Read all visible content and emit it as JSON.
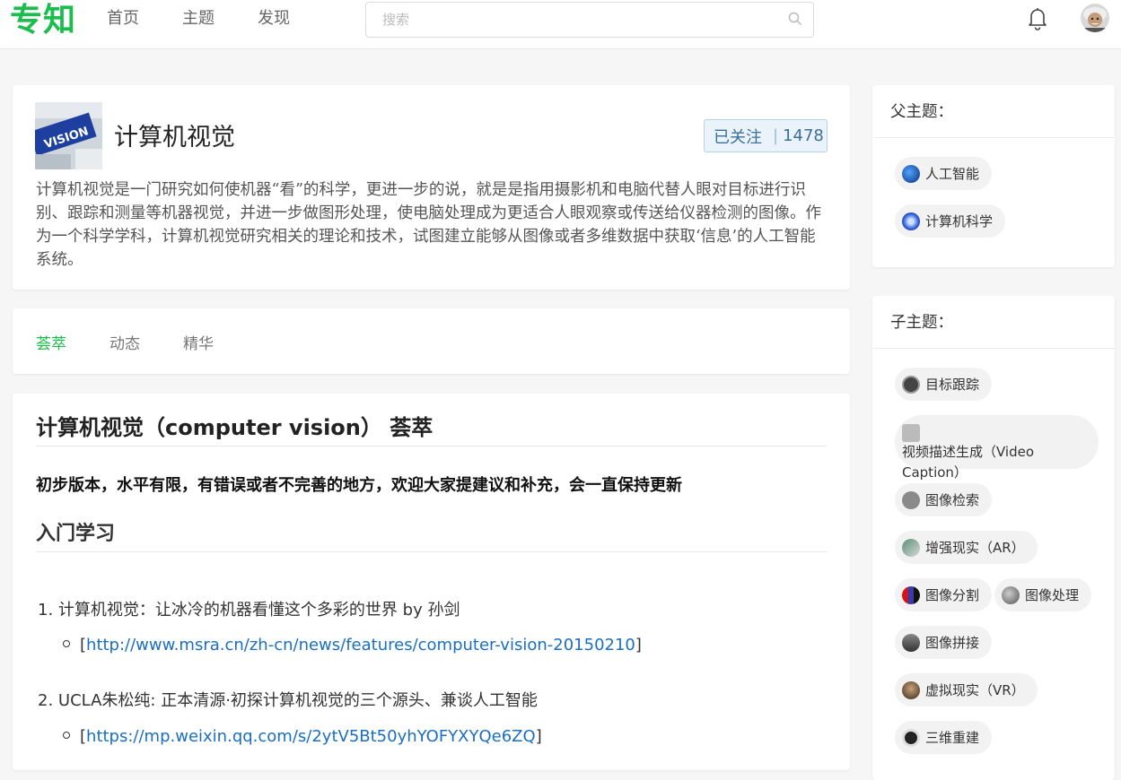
{
  "header": {
    "logo": "专知",
    "nav": [
      "首页",
      "主题",
      "发现"
    ],
    "search_placeholder": "搜索"
  },
  "topic": {
    "title": "计算机视觉",
    "image_label": "VISION",
    "follow_label": "已关注",
    "follow_count": "1478",
    "description": "计算机视觉是一门研究如何使机器“看”的科学，更进一步的说，就是是指用摄影机和电脑代替人眼对目标进行识别、跟踪和测量等机器视觉，并进一步做图形处理，使电脑处理成为更适合人眼观察或传送给仪器检测的图像。作为一个科学学科，计算机视觉研究相关的理论和技术，试图建立能够从图像或者多维数据中获取‘信息’的人工智能系统。"
  },
  "tabs": [
    "荟萃",
    "动态",
    "精华"
  ],
  "content": {
    "title": "计算机视觉（computer vision） 荟萃",
    "note": "初步版本，水平有限，有错误或者不完善的地方，欢迎大家提建议和补充，会一直保持更新",
    "section": "入门学习",
    "items": [
      {
        "num": "1.",
        "text": "计算机视觉：让冰冷的机器看懂这个多彩的世界 by 孙剑",
        "link": "http://www.msra.cn/zh-cn/news/features/computer-vision-20150210"
      },
      {
        "num": "2.",
        "text": "UCLA朱松纯: 正本清源·初探计算机视觉的三个源头、兼谈人工智能",
        "link": "https://mp.weixin.qq.com/s/2ytV5Bt50yhYOFYXYQe6ZQ"
      }
    ]
  },
  "sidebar": {
    "parent_title": "父主题：",
    "parents": [
      "人工智能",
      "计算机科学"
    ],
    "child_title": "子主题：",
    "children": [
      "目标跟踪",
      "视频描述生成（Video Caption）",
      "图像检索",
      "增强现实（AR）",
      "图像分割",
      "图像处理",
      "图像拼接",
      "虚拟现实（VR）",
      "三维重建"
    ]
  },
  "colors": {
    "brand": "#1bbd4c",
    "link": "#1a6fc2",
    "follow_bg": "#eaf3fa"
  }
}
